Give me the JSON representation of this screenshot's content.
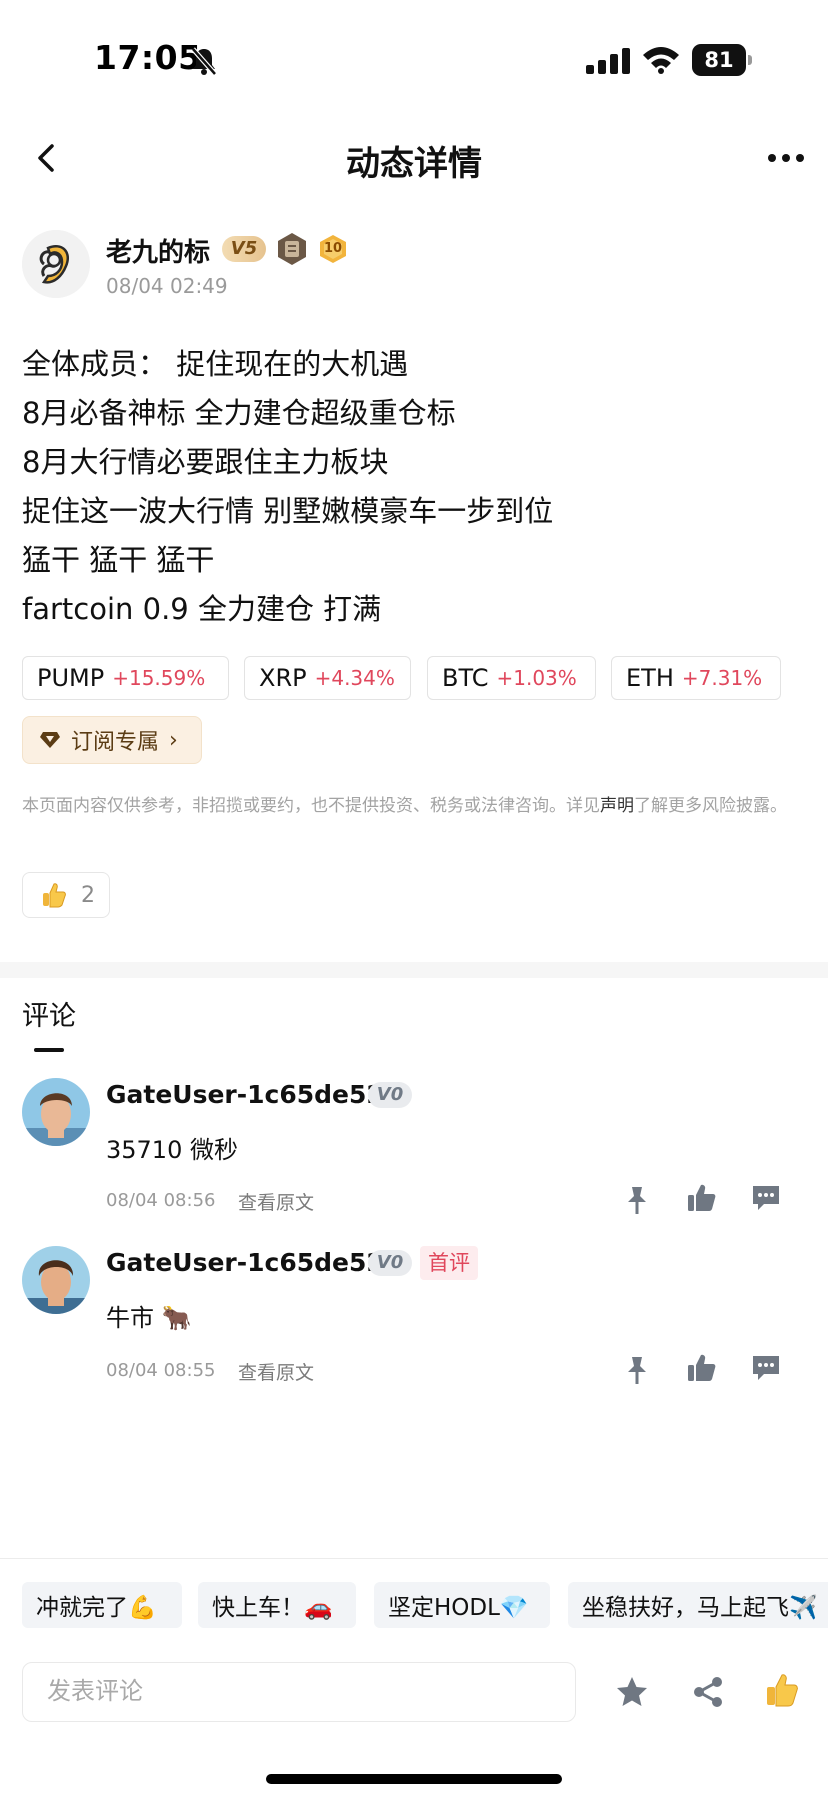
{
  "status": {
    "time": "17:05",
    "battery": "81"
  },
  "nav": {
    "title": "动态详情"
  },
  "post": {
    "author": "老九的标",
    "vip_level": "V5",
    "medal_number": "10",
    "date": "08/04 02:49",
    "lines": [
      "全体成员：  捉住现在的大机遇",
      "8月必备神标 全力建仓超级重仓标",
      "8月大行情必要跟住主力板块",
      "捉住这一波大行情 别墅嫩模豪车一步到位",
      "猛干 猛干 猛干",
      "fartcoin 0.9 全力建仓 打满"
    ],
    "tickers": [
      {
        "symbol": "PUMP",
        "change": "+15.59%"
      },
      {
        "symbol": "XRP",
        "change": "+4.34%"
      },
      {
        "symbol": "BTC",
        "change": "+1.03%"
      },
      {
        "symbol": "ETH",
        "change": "+7.31%"
      }
    ],
    "subscribe_label": "订阅专属",
    "disclaimer_pre": "本页面内容仅供参考，非招揽或要约，也不提供投资、税务或法律咨询。详见",
    "disclaimer_link": "声明",
    "disclaimer_post": "了解更多风险披露。",
    "like_count": "2"
  },
  "comments": {
    "heading": "评论",
    "view_original": "查看原文",
    "items": [
      {
        "user": "GateUser-1c65de52",
        "level": "V0",
        "text": "35710 微秒",
        "date": "08/04 08:56"
      },
      {
        "user": "GateUser-1c65de52",
        "level": "V0",
        "first_badge": "首评",
        "text": "牛市 🐂",
        "date": "08/04 08:55"
      }
    ]
  },
  "quick_replies": [
    "冲就完了💪",
    "快上车！🚗",
    "坚定HODL💎",
    "坐稳扶好，马上起飞✈️"
  ],
  "input": {
    "placeholder": "发表评论"
  },
  "colors": {
    "up": "#e0475c",
    "badge_gold": "#e6c38f"
  }
}
